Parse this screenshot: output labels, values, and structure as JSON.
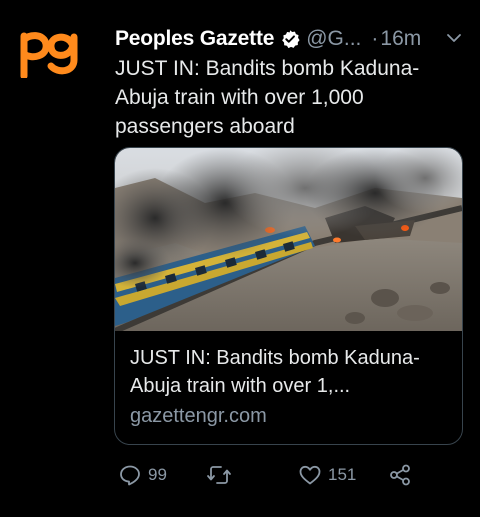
{
  "tweet": {
    "author_name": "Peoples Gazette",
    "handle": "@G...",
    "separator": "·",
    "time": "16m",
    "text": "JUST IN: Bandits bomb Kaduna-Abuja train with over 1,000 passengers aboard",
    "avatar_logo_text": "pg"
  },
  "card": {
    "title": "JUST IN: Bandits bomb Kaduna-Abuja train with over 1,...",
    "domain": "gazettengr.com"
  },
  "actions": {
    "replies": "99",
    "retweets": "",
    "likes": "151"
  },
  "colors": {
    "brand_orange": "#ff8a1c",
    "verified_fill": "#ffffff",
    "muted": "#8b98a5",
    "text": "#e7e9ea",
    "card_border": "#38444d"
  },
  "icons": {
    "more": "chevron-down-icon",
    "verified": "verified-badge-icon",
    "reply": "reply-icon",
    "retweet": "retweet-icon",
    "like": "heart-icon",
    "share": "share-icon"
  }
}
